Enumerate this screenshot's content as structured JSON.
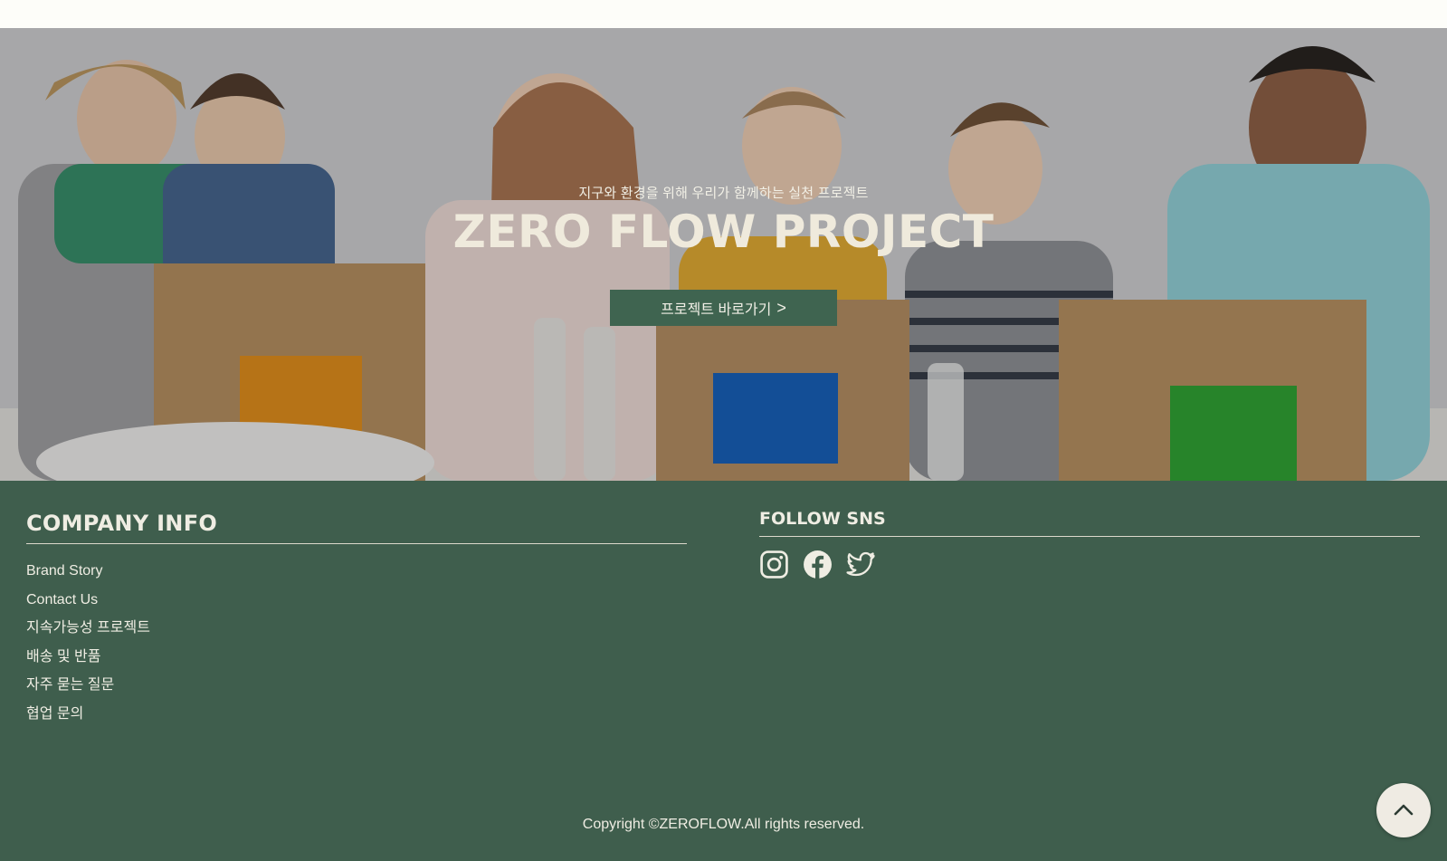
{
  "hero": {
    "subtitle": "지구와 환경을 위해 우리가 함께하는 실천 프로젝트",
    "title": "ZERO FLOW PROJECT",
    "button_label": "프로젝트 바로가기",
    "button_arrow": ">",
    "image": "kids-sorting-recycling-boxes"
  },
  "footer": {
    "company_heading": "COMPANY INFO",
    "links": [
      {
        "label": "Brand Story"
      },
      {
        "label": "Contact Us"
      },
      {
        "label": "지속가능성 프로젝트"
      },
      {
        "label": "배송 및 반품"
      },
      {
        "label": "자주 묻는 질문"
      },
      {
        "label": "협업 문의"
      }
    ],
    "sns_heading": "FOLLOW SNS",
    "sns": [
      {
        "icon": "instagram-icon"
      },
      {
        "icon": "facebook-icon"
      },
      {
        "icon": "twitter-icon"
      }
    ],
    "copyright": "Copyright ©ZEROFLOW.All rights reserved."
  },
  "scroll_top": {
    "icon": "chevron-up-icon"
  },
  "colors": {
    "footer_bg": "#3f5e4d",
    "button_bg": "#3f6450",
    "text_light": "#efede3",
    "topbar_bg": "#fdfdf9"
  }
}
